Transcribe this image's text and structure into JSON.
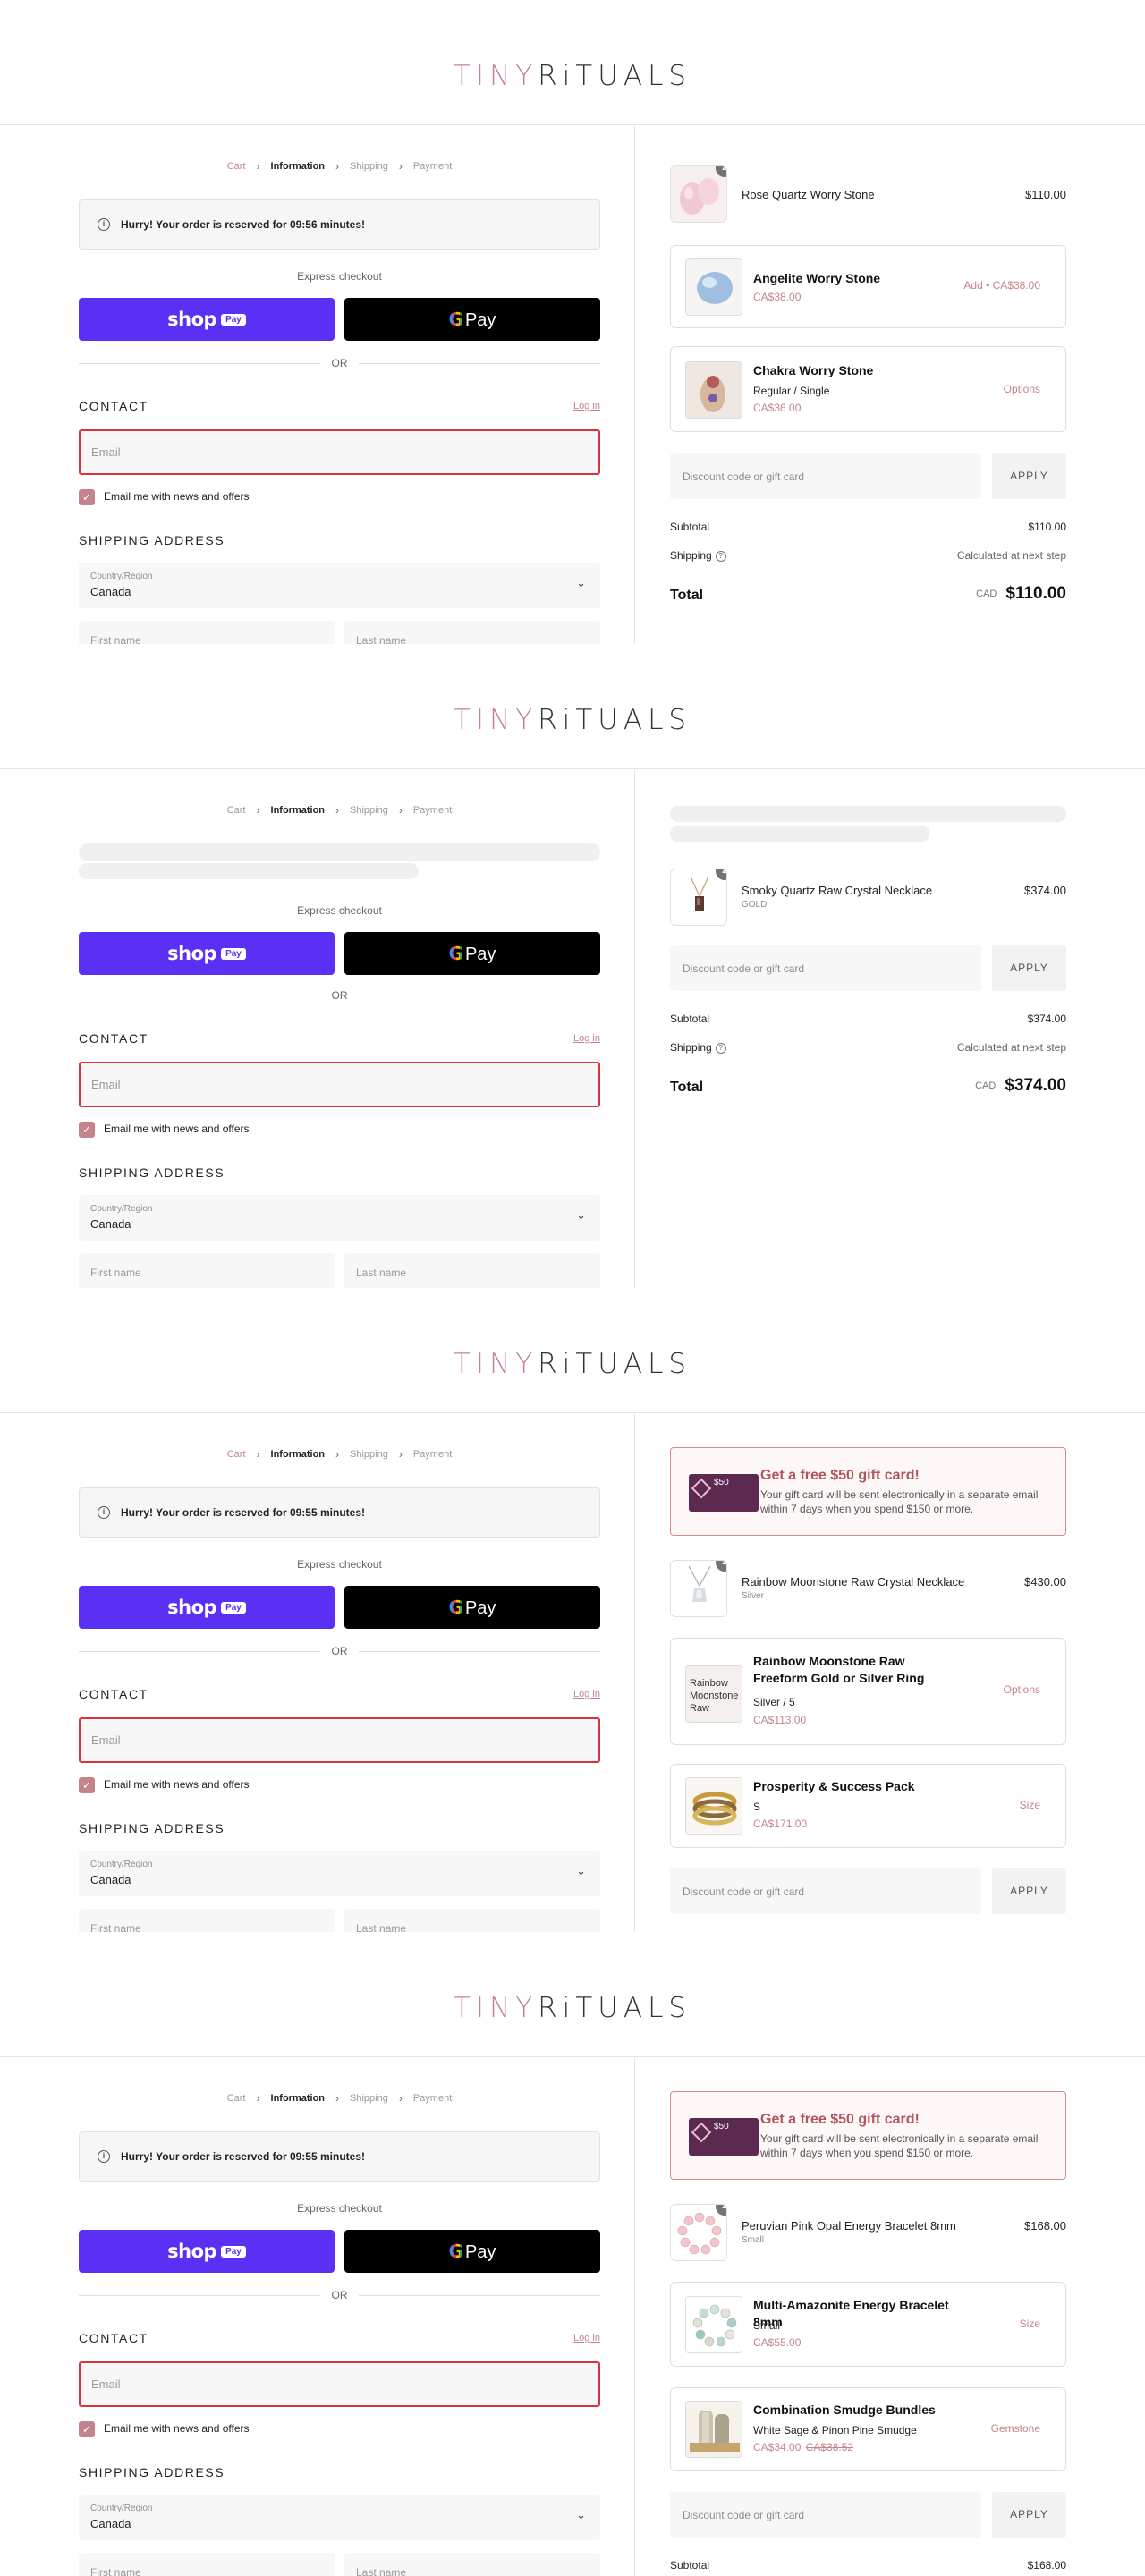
{
  "brand": {
    "part1": "TINY",
    "part2": "RiTUALS"
  },
  "breadcrumbs": [
    "Cart",
    "Information",
    "Shipping",
    "Payment"
  ],
  "checkout": {
    "express_label": "Express checkout",
    "shop_pay_word": "shop",
    "shop_pay_badge": "Pay",
    "gpay_g": "G",
    "gpay_word": "Pay",
    "or_label": "OR",
    "contact_heading": "CONTACT",
    "login_label": "Log in",
    "email_placeholder": "Email",
    "newsletter_label": "Email me with news and offers",
    "shipping_heading": "SHIPPING ADDRESS",
    "country_label": "Country/Region",
    "country_value": "Canada",
    "first_name_placeholder": "First name",
    "last_name_placeholder": "Last name"
  },
  "summary_labels": {
    "discount_placeholder": "Discount code or gift card",
    "apply": "APPLY",
    "subtotal": "Subtotal",
    "shipping": "Shipping",
    "shipping_value": "Calculated at next step",
    "total": "Total",
    "currency": "CAD"
  },
  "gift_promo": {
    "card_amount": "$50",
    "title": "Get a free $50 gift card!",
    "desc": "Your gift card will be sent electronically in a separate email within 7 days when you spend $150 or more."
  },
  "panels": [
    {
      "timer": "Hurry! Your order is reserved for 09:56 minutes!",
      "item": {
        "qty": "2",
        "name": "Rose Quartz Worry Stone",
        "variant": "",
        "price": "$110.00"
      },
      "upsells": [
        {
          "title": "Angelite Worry Stone",
          "sub": "",
          "price": "CA$38.00",
          "action": "Add • CA$38.00"
        },
        {
          "title": "Chakra Worry Stone",
          "sub": "Regular / Single",
          "price": "CA$36.00",
          "action": "Options"
        }
      ],
      "subtotal": "$110.00",
      "total": "$110.00"
    },
    {
      "item": {
        "qty": "2",
        "name": "Smoky Quartz Raw Crystal Necklace",
        "variant": "GOLD",
        "price": "$374.00"
      },
      "subtotal": "$374.00",
      "total": "$374.00"
    },
    {
      "timer": "Hurry! Your order is reserved for 09:55 minutes!",
      "item": {
        "qty": "2",
        "name": "Rainbow Moonstone Raw Crystal Necklace",
        "variant": "Silver",
        "price": "$430.00"
      },
      "upsells": [
        {
          "title": "Rainbow Moonstone Raw Freeform Gold or Silver Ring",
          "sub": "Silver / 5",
          "price": "CA$113.00",
          "action": "Options",
          "thumb_text": "Rainbow Moonstone Raw"
        },
        {
          "title": "Prosperity & Success Pack",
          "sub": "S",
          "price": "CA$171.00",
          "action": "Size"
        }
      ]
    },
    {
      "timer": "Hurry! Your order is reserved for 09:55 minutes!",
      "item": {
        "qty": "2",
        "name": "Peruvian Pink Opal Energy Bracelet 8mm",
        "variant": "Small",
        "price": "$168.00"
      },
      "upsells": [
        {
          "title": "Multi-Amazonite Energy Bracelet 8mm",
          "sub": "Small",
          "price": "CA$55.00",
          "action": "Size"
        },
        {
          "title": "Combination Smudge Bundles",
          "sub": "White Sage & Pinon Pine Smudge",
          "price": "CA$34.00",
          "compare": "CA$38.52",
          "action": "Gemstone"
        }
      ],
      "subtotal": "$168.00"
    }
  ]
}
